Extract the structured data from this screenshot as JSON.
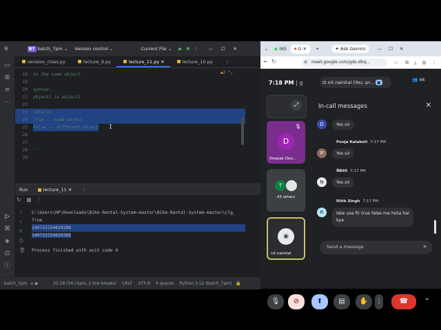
{
  "ide": {
    "project_badge": "B7",
    "project_name": "batch_7pm",
    "vcs": "Version control",
    "run_config": "Current File",
    "tabs": [
      {
        "label": "revision_class.py"
      },
      {
        "label": "lecture_9.py"
      },
      {
        "label": "lecture_11.py"
      },
      {
        "label": "lecture_10.py"
      }
    ],
    "inspection_count": "2",
    "editor_lines": [
      {
        "num": "18",
        "text": "to the same object."
      },
      {
        "num": "19",
        "text": ""
      },
      {
        "num": "20",
        "text": "syntax:"
      },
      {
        "num": "21",
        "text": "object1 is object2"
      },
      {
        "num": "22",
        "text": ""
      },
      {
        "num": "23",
        "text": "returns:"
      },
      {
        "num": "24",
        "text": "True -- same object"
      },
      {
        "num": "25",
        "text": "False -- different object"
      },
      {
        "num": "26",
        "text": ""
      },
      {
        "num": "27",
        "text": ""
      },
      {
        "num": "28",
        "text": "'''"
      },
      {
        "num": "29",
        "text": ""
      }
    ],
    "run_tab_label": "Run",
    "run_config_tab": "lecture_11",
    "console_lines": [
      "C:\\Users\\HP\\Downloads\\Bike-Rental-System-master\\Bike-Rental-System-master\\clg_",
      "True",
      "140733154839288",
      "140733154839288",
      "",
      "Process finished with exit code 0"
    ],
    "status": {
      "project": "batch_7pm",
      "position": "25:28 (54 chars, 2 line breaks)",
      "line_sep": "CRLF",
      "encoding": "UTF-8",
      "indent": "4 spaces",
      "interpreter": "Python 3.12 (batch_7pm)"
    }
  },
  "chrome": {
    "tab1": "(65",
    "tab2": "G",
    "tab_ask": "Ask Gemini",
    "url": "meet.google.com/gdx-dhq..."
  },
  "meet": {
    "time": "7:18 PM",
    "time_suffix": "| g",
    "presenter": "nit nainital (You, pr...",
    "participant_count": "46",
    "tiles": {
      "deepak_initial": "D",
      "deepak": "Deepak Deo...",
      "others_initial": "T",
      "others": "43 others",
      "self": "nit nainital"
    },
    "panel": {
      "title": "In-call messages",
      "messages": [
        {
          "initial": "D",
          "sender": "",
          "time": "",
          "text": "Yes sir"
        },
        {
          "initial": "P",
          "sender": "Pooja Kalakoti",
          "time": "7:17 PM",
          "text": "Yes sir"
        },
        {
          "initial": "N",
          "sender": "ÑÐHI",
          "time": "7:17 PM",
          "text": "Yes sir"
        },
        {
          "initial": "R",
          "sender": "Ritik Singh",
          "time": "7:17 PM",
          "text": "Iske use fir true false me hota hai\nkya"
        }
      ],
      "send_placeholder": "Send a message"
    }
  },
  "colors": {
    "selection": "#214283",
    "comment": "#5f826b",
    "accent": "#3574f0",
    "hangup": "#dc362e",
    "presenting": "#a8c7fa"
  }
}
